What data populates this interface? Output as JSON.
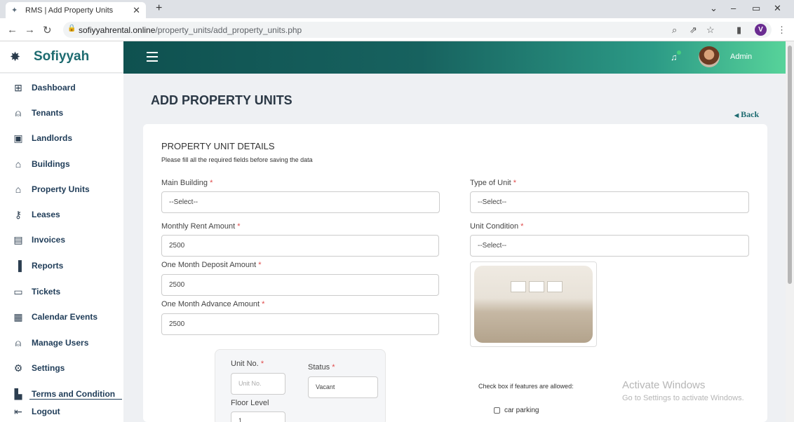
{
  "browser": {
    "tab_title": "RMS | Add Property Units",
    "url_host": "sofiyyahrental.online",
    "url_path": "/property_units/add_property_units.php",
    "profile_initial": "V"
  },
  "app": {
    "brand": "Sofiyyah",
    "user_name": "Admin"
  },
  "sidebar": {
    "items": [
      {
        "label": "Dashboard",
        "icon": "grid-icon"
      },
      {
        "label": "Tenants",
        "icon": "person-icon"
      },
      {
        "label": "Landlords",
        "icon": "contact-card-icon"
      },
      {
        "label": "Buildings",
        "icon": "building-icon"
      },
      {
        "label": "Property Units",
        "icon": "home-icon"
      },
      {
        "label": "Leases",
        "icon": "key-icon"
      },
      {
        "label": "Invoices",
        "icon": "invoice-icon"
      },
      {
        "label": "Reports",
        "icon": "bar-chart-icon"
      },
      {
        "label": "Tickets",
        "icon": "ticket-icon"
      },
      {
        "label": "Calendar Events",
        "icon": "calendar-icon"
      },
      {
        "label": "Manage Users",
        "icon": "add-user-icon"
      },
      {
        "label": "Settings",
        "icon": "gear-icon"
      },
      {
        "label": "Terms and Condition",
        "icon": "book-icon"
      },
      {
        "label": "Logout",
        "icon": "logout-icon"
      }
    ]
  },
  "page": {
    "title": "ADD PROPERTY UNITS",
    "back_label": "Back"
  },
  "form": {
    "section_title": "PROPERTY UNIT DETAILS",
    "section_subtitle": "Please fill all the required fields before saving the data",
    "required_mark": "*",
    "main_building": {
      "label": "Main Building",
      "value": "--Select--"
    },
    "type_of_unit": {
      "label": "Type of Unit",
      "value": "--Select--"
    },
    "monthly_rent": {
      "label": "Monthly Rent Amount",
      "value": "2500"
    },
    "unit_condition": {
      "label": "Unit Condition",
      "value": "--Select--"
    },
    "deposit": {
      "label": "One Month Deposit Amount",
      "value": "2500"
    },
    "advance": {
      "label": "One Month Advance Amount",
      "value": "2500"
    },
    "unit_no": {
      "label": "Unit No.",
      "placeholder": "Unit No."
    },
    "status": {
      "label": "Status",
      "value": "Vacant"
    },
    "floor_level": {
      "label": "Floor Level",
      "value": "1"
    },
    "features_label": "Check box if features are allowed:",
    "features": [
      {
        "label": "car parking",
        "checked": false
      }
    ]
  },
  "watermark": {
    "line1": "Activate Windows",
    "line2": "Go to Settings to activate Windows."
  },
  "colors": {
    "brand": "#1d6b70",
    "topbar_start": "#0f5150",
    "topbar_end": "#57d39a",
    "required": "#e04b4b"
  }
}
